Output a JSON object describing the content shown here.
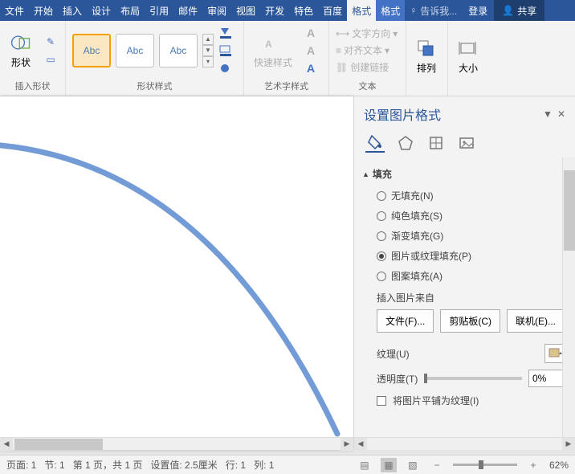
{
  "tabs": {
    "file": "文件",
    "home": "开始",
    "insert": "插入",
    "design": "设计",
    "layout": "布局",
    "references": "引用",
    "mailings": "邮件",
    "review": "审阅",
    "view": "视图",
    "developer": "开发",
    "addins": "特色",
    "baidu": "百度",
    "format1": "格式",
    "format2": "格式"
  },
  "tellme": "告诉我...",
  "login": "登录",
  "share": "共享",
  "ribbon": {
    "insert_shape": "插入形状",
    "shape": "形状",
    "shape_styles": "形状样式",
    "abc": "Abc",
    "wordart_styles": "艺术字样式",
    "quick_styles": "快速样式",
    "text": "文本",
    "text_direction": "文字方向",
    "align_text": "对齐文本",
    "create_link": "创建链接",
    "arrange": "排列",
    "size": "大小"
  },
  "pane": {
    "title": "设置图片格式",
    "section_fill": "填充",
    "fill": {
      "none": "无填充(N)",
      "solid": "纯色填充(S)",
      "gradient": "渐变填充(G)",
      "picture": "图片或纹理填充(P)",
      "pattern": "图案填充(A)"
    },
    "insert_from": "插入图片来自",
    "btn_file": "文件(F)...",
    "btn_clipboard": "剪贴板(C)",
    "btn_online": "联机(E)...",
    "texture": "纹理(U)",
    "transparency": "透明度(T)",
    "transparency_val": "0%",
    "tile": "将图片平铺为纹理(I)"
  },
  "status": {
    "page": "页面: 1",
    "section": "节: 1",
    "pages": "第 1 页，共 1 页",
    "setval": "设置值: 2.5厘米",
    "line": "行: 1",
    "col": "列: 1",
    "zoom": "62%"
  }
}
